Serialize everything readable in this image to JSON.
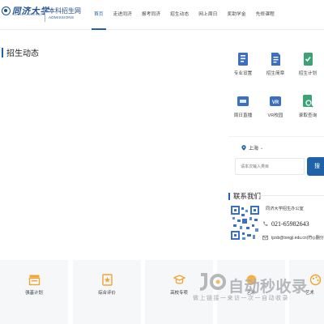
{
  "brand": {
    "university_cn": "同济大学",
    "university_en": "TONGJI UNIVERSITY",
    "admissions_cn": "本科招生网",
    "admissions_en": "ADMISSIONS"
  },
  "nav": {
    "items": [
      {
        "label": "首页",
        "active": true
      },
      {
        "label": "走进同济",
        "active": false
      },
      {
        "label": "报考同济",
        "active": false
      },
      {
        "label": "招生动态",
        "active": false
      },
      {
        "label": "网上周日",
        "active": false
      },
      {
        "label": "奖助学金",
        "active": false
      },
      {
        "label": "先修课程",
        "active": false
      }
    ]
  },
  "section": {
    "title": "招生动态"
  },
  "quick_links": [
    {
      "label": "专业设置",
      "icon": "book-list-icon"
    },
    {
      "label": "招生简章",
      "icon": "document-icon"
    },
    {
      "label": "招生计划",
      "icon": "checklist-icon"
    },
    {
      "label": "周日直播",
      "icon": "live-tv-icon"
    },
    {
      "label": "VR校园",
      "icon": "vr-icon"
    },
    {
      "label": "录取查询",
      "icon": "search-document-icon"
    }
  ],
  "location": {
    "selected": "上海",
    "search_placeholder": "请本次输入类目",
    "search_button": "搜"
  },
  "contact": {
    "title": "联系我们",
    "office": "同济大学招生办公室",
    "phone": "021-65982643",
    "email": "tjzsb@tongji.edu.cn(符◎翻分"
  },
  "cards": [
    {
      "label": "强基计划"
    },
    {
      "label": "综合评价"
    },
    {
      "label": "高校专项"
    },
    {
      "label": "艺术"
    },
    {
      "label": "艺术"
    }
  ],
  "watermark": {
    "big": "自动秒收录",
    "small": "做上链接一来访一次一自动收录"
  },
  "colors": {
    "brand_blue": "#1f4e8c",
    "accent_blue": "#1f62a8",
    "icon_blue": "#3a6fc4",
    "icon_green": "#3ba374"
  }
}
